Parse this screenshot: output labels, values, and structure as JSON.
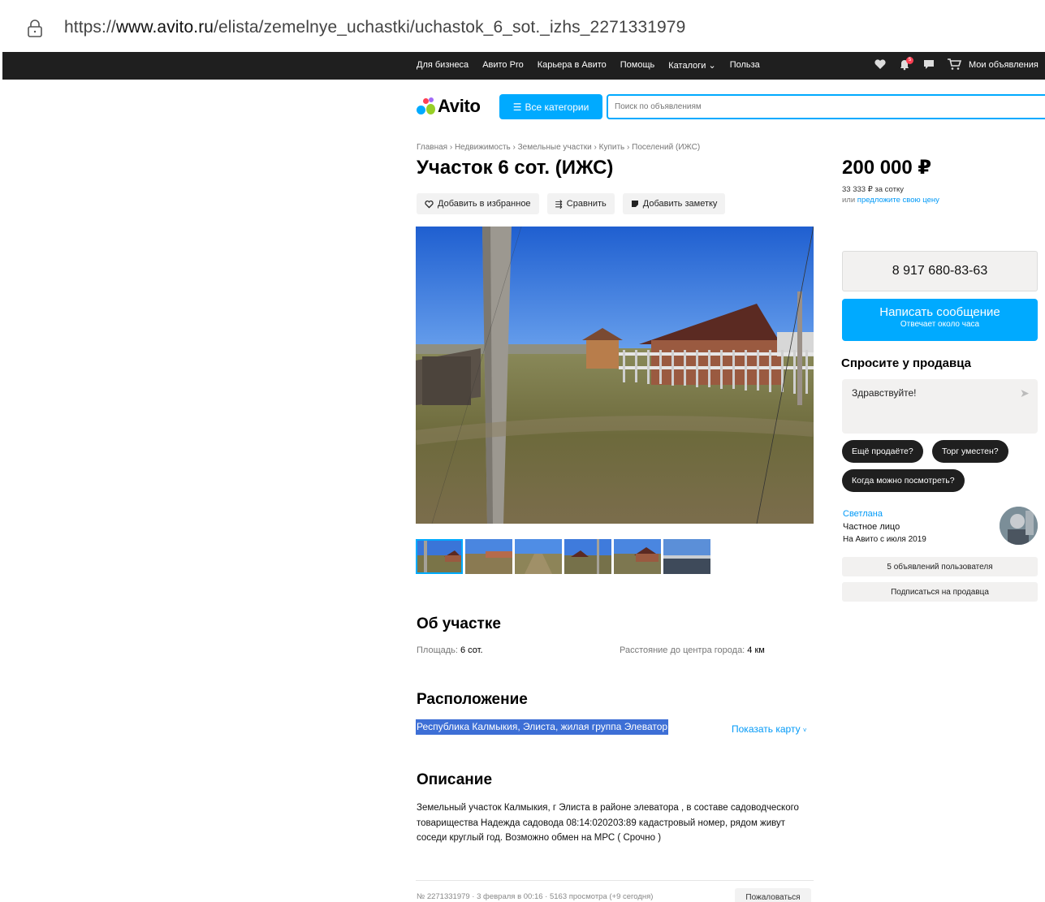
{
  "browser": {
    "url_prefix": "https://",
    "url_domain": "www.avito.ru",
    "url_path": "/elista/zemelnye_uchastki/uchastok_6_sot._izhs_2271331979"
  },
  "topnav": {
    "links": [
      "Для бизнеса",
      "Авито Pro",
      "Карьера в Авито",
      "Помощь",
      "Каталоги",
      "Польза"
    ],
    "notifications_count": "5",
    "my_ads": "Мои объявления"
  },
  "header": {
    "logo_text": "Avito",
    "categories_button": "Все категории",
    "search_placeholder": "Поиск по объявлениям"
  },
  "breadcrumb": "Главная › Недвижимость › Земельные участки › Купить › Поселений (ИЖС)",
  "listing": {
    "title": "Участок 6 сот. (ИЖС)",
    "actions": {
      "favorite": "Добавить в избранное",
      "compare": "Сравнить",
      "note": "Добавить заметку"
    },
    "thumbnail_count": 6,
    "about_title": "Об участке",
    "params": {
      "area_label": "Площадь: ",
      "area_value": "6 сот.",
      "distance_label": "Расстояние до центра города: ",
      "distance_value": "4 км"
    },
    "location_title": "Расположение",
    "address": "Республика Калмыкия, Элиста, жилая группа Элеватор",
    "show_map": "Показать карту",
    "description_title": "Описание",
    "description": "Земельный участок Калмыкия, г Элиста в районе элеватора , в составе садоводческого товарищества Надежда садовода 08:14:020203:89 кадастровый номер, рядом живут соседи круглый год. Возможно обмен на МРС ( Срочно )",
    "footer_meta": "№ 2271331979 · 3 февраля в 00:16 · 5163 просмотра (+9 сегодня)",
    "complain": "Пожаловаться"
  },
  "sidebar": {
    "price": "200 000 ₽",
    "price_per_unit": "33 333 ₽ за сотку",
    "offer_prefix": "или ",
    "offer_link": "предложите свою цену",
    "phone": "8 917 680-83-63",
    "message_button": "Написать сообщение",
    "message_sub": "Отвечает около часа",
    "ask_title": "Спросите у продавца",
    "ask_placeholder": "Здравствуйте!",
    "chips": [
      "Ещё продаёте?",
      "Торг уместен?",
      "Когда можно посмотреть?"
    ],
    "seller": {
      "name": "Светлана",
      "type": "Частное лицо",
      "since": "На Авито с июля 2019"
    },
    "seller_ads_button": "5 объявлений пользователя",
    "subscribe_button": "Подписаться на продавца"
  },
  "colors": {
    "accent": "#00aaff",
    "link": "#0099f7",
    "topbar": "#1f1f1f",
    "selection": "#3d6fd6"
  }
}
